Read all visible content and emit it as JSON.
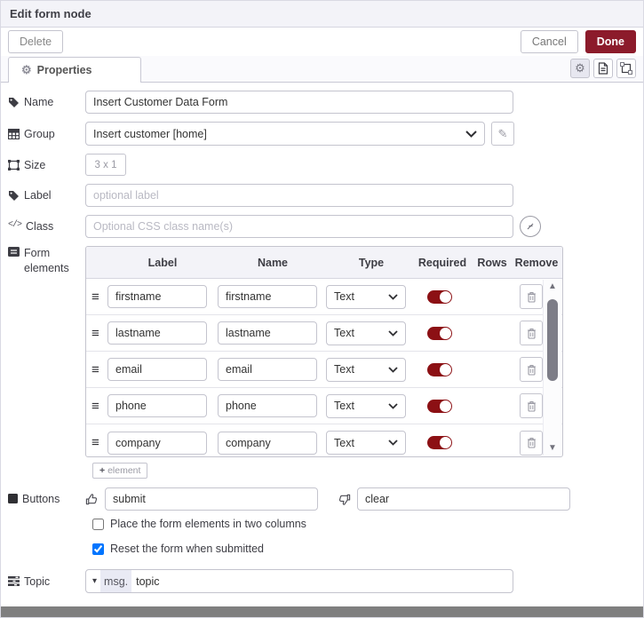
{
  "window": {
    "title": "Edit form node"
  },
  "toolbar": {
    "delete": "Delete",
    "cancel": "Cancel",
    "done": "Done"
  },
  "tabbar": {
    "properties": "Properties"
  },
  "fields": {
    "name": {
      "label": "Name",
      "value": "Insert Customer Data Form"
    },
    "group": {
      "label": "Group",
      "value": "Insert customer [home]"
    },
    "size": {
      "label": "Size",
      "value": "3 x 1"
    },
    "node_label": {
      "label": "Label",
      "placeholder": "optional label"
    },
    "css_class": {
      "label": "Class",
      "placeholder": "Optional CSS class name(s)"
    }
  },
  "form_elements": {
    "section_label": "Form elements",
    "columns": [
      "Label",
      "Name",
      "Type",
      "Required",
      "Rows",
      "Remove"
    ],
    "rows": [
      {
        "label": "firstname",
        "name": "firstname",
        "type": "Text",
        "required": true
      },
      {
        "label": "lastname",
        "name": "lastname",
        "type": "Text",
        "required": true
      },
      {
        "label": "email",
        "name": "email",
        "type": "Text",
        "required": true
      },
      {
        "label": "phone",
        "name": "phone",
        "type": "Text",
        "required": true
      },
      {
        "label": "company",
        "name": "company",
        "type": "Text",
        "required": true
      }
    ],
    "add_button": "element"
  },
  "buttons_section": {
    "label": "Buttons",
    "submit": "submit",
    "clear": "clear"
  },
  "options": [
    {
      "label": "Place the form elements in two columns",
      "checked": false
    },
    {
      "label": "Reset the form when submitted",
      "checked": true
    }
  ],
  "topic": {
    "label": "Topic",
    "prefix": "msg.",
    "value": "topic"
  },
  "colors": {
    "accent_red": "#8c1b2b",
    "toggle_red": "#8c1014",
    "header_bg": "#f3f3f8",
    "border": "#c4c4ce"
  }
}
